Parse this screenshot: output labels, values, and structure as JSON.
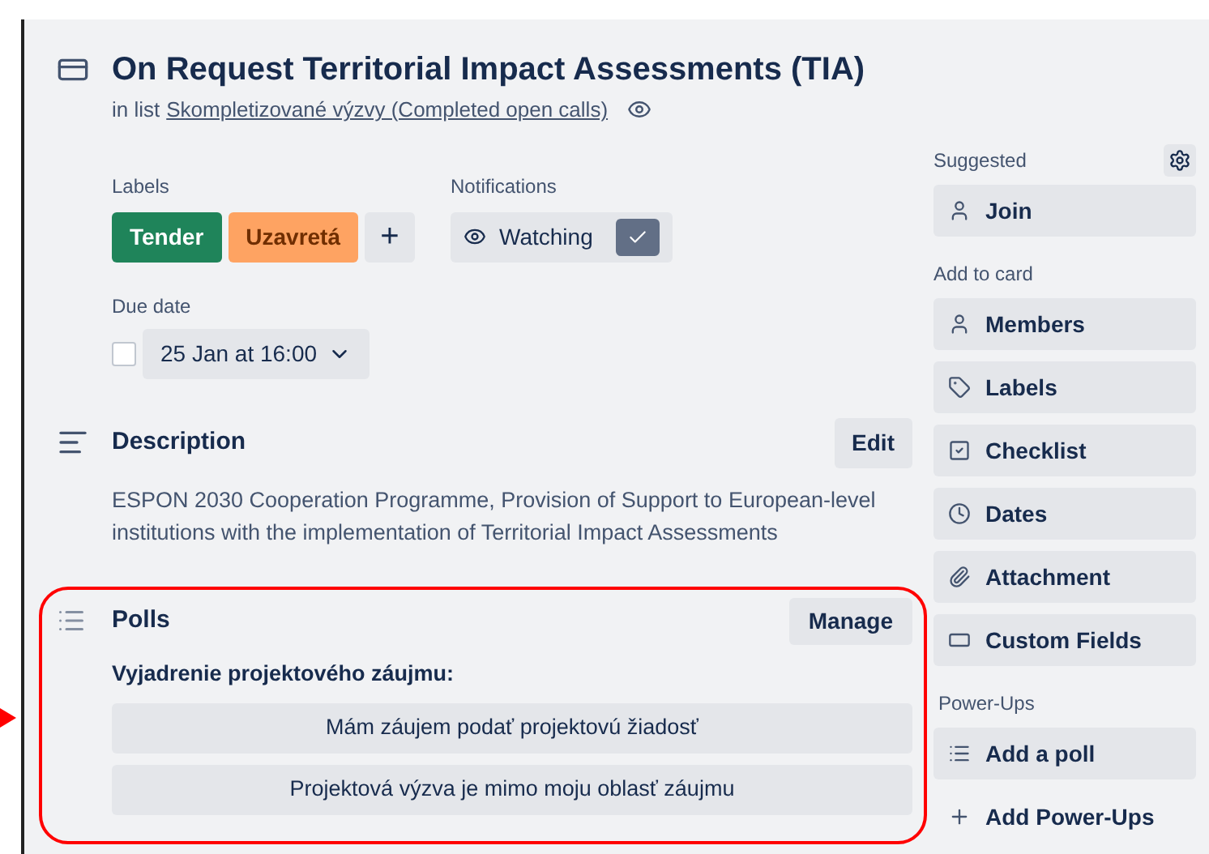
{
  "card": {
    "title": "On Request Territorial Impact Assessments (TIA)",
    "list_prefix": "in list",
    "list_name": "Skompletizované výzvy (Completed open calls)"
  },
  "labels": {
    "heading": "Labels",
    "items": [
      {
        "text": "Tender",
        "color": "#1f845a"
      },
      {
        "text": "Uzavretá",
        "color": "#fea362"
      }
    ],
    "add": "+"
  },
  "notifications": {
    "heading": "Notifications",
    "button": "Watching",
    "checked": true
  },
  "due_date": {
    "heading": "Due date",
    "value": "25 Jan at 16:00",
    "checked": false
  },
  "description": {
    "heading": "Description",
    "edit": "Edit",
    "text": "ESPON 2030 Cooperation Programme, Provision of Support to European-level institutions with the implementation of Territorial Impact Assessments"
  },
  "polls": {
    "heading": "Polls",
    "manage": "Manage",
    "question": "Vyjadrenie projektového záujmu:",
    "options": [
      "Mám záujem podať projektovú žiadosť",
      "Projektová výzva je mimo moju oblasť záujmu"
    ]
  },
  "sidebar": [
    {
      "heading": "Suggested",
      "items": [
        {
          "kind": "button",
          "label": "Join"
        }
      ]
    },
    {
      "heading": "Add to card",
      "items": [
        {
          "kind": "button",
          "label": "Members"
        },
        {
          "kind": "button",
          "label": "Labels"
        },
        {
          "kind": "button",
          "label": "Checklist"
        },
        {
          "kind": "button",
          "label": "Dates"
        },
        {
          "kind": "button",
          "label": "Attachment"
        },
        {
          "kind": "button",
          "label": "Custom Fields"
        }
      ]
    },
    {
      "heading": "Power-Ups",
      "items": [
        {
          "kind": "button",
          "label": "Add a poll"
        },
        {
          "kind": "link",
          "label": "Add Power-Ups"
        }
      ]
    }
  ]
}
